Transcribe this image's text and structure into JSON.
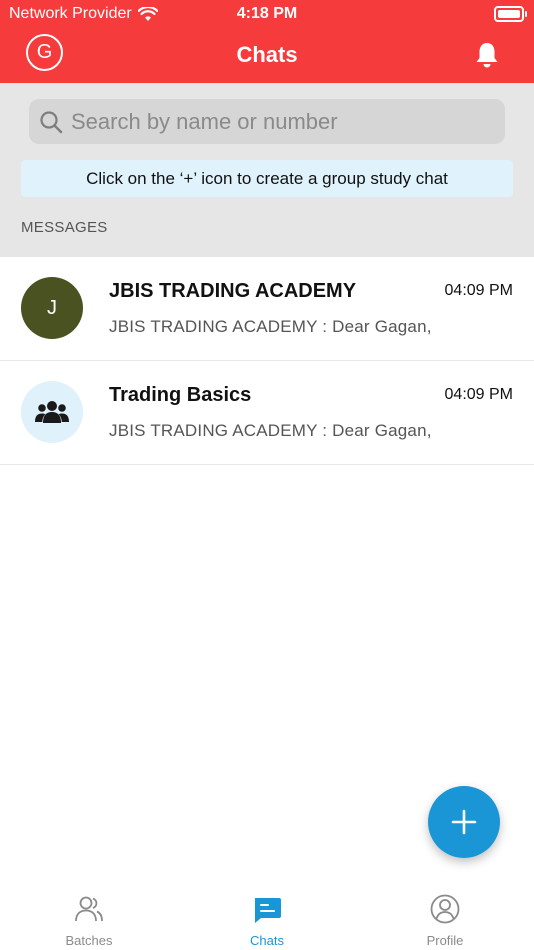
{
  "status_bar": {
    "carrier": "Network Provider",
    "time": "4:18 PM"
  },
  "header": {
    "avatar_letter": "G",
    "title": "Chats"
  },
  "search": {
    "placeholder": "Search by name or number"
  },
  "info_banner": "Click on the ‘+’ icon to create a group study chat",
  "section_label": "MESSAGES",
  "chats": [
    {
      "avatar_letter": "J",
      "name": "JBIS TRADING ACADEMY",
      "time": "04:09 PM",
      "preview": "JBIS TRADING ACADEMY : Dear Gagan,",
      "avatar_color": "#4a5222"
    },
    {
      "avatar_icon": "group-icon",
      "name": "Trading Basics",
      "time": "04:09 PM",
      "preview": "JBIS TRADING ACADEMY : Dear Gagan,",
      "avatar_color": "#dff1fb"
    }
  ],
  "tabs": [
    {
      "label": "Batches",
      "icon": "batches-icon"
    },
    {
      "label": "Chats",
      "icon": "chats-icon",
      "active": true
    },
    {
      "label": "Profile",
      "icon": "profile-icon"
    }
  ],
  "colors": {
    "header": "#f53b3b",
    "accent": "#1a96d6",
    "panel": "#e6e6e6"
  }
}
